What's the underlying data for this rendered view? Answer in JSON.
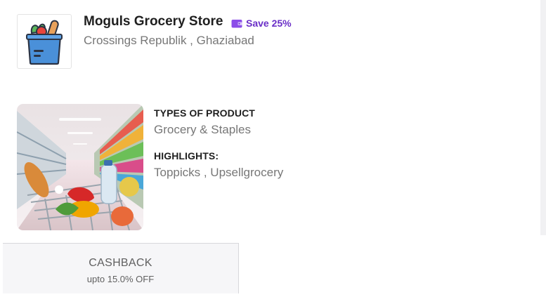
{
  "store": {
    "name": "Moguls Grocery Store",
    "location": "Crossings Republik , Ghaziabad",
    "logo_icon": "grocery-bag-icon",
    "badge": {
      "icon": "wallet-icon",
      "text": "Save 25%",
      "color": "#6a2fc7"
    }
  },
  "product_image": {
    "icon": "shopping-cart-aisle-image"
  },
  "details": {
    "types_label": "TYPES OF PRODUCT",
    "types_value": "Grocery & Staples",
    "highlights_label": "HIGHLIGHTS:",
    "highlights_value": "Toppicks , Upsellgrocery"
  },
  "cashback": {
    "title": "CASHBACK",
    "subtitle": "upto 15.0% OFF"
  }
}
